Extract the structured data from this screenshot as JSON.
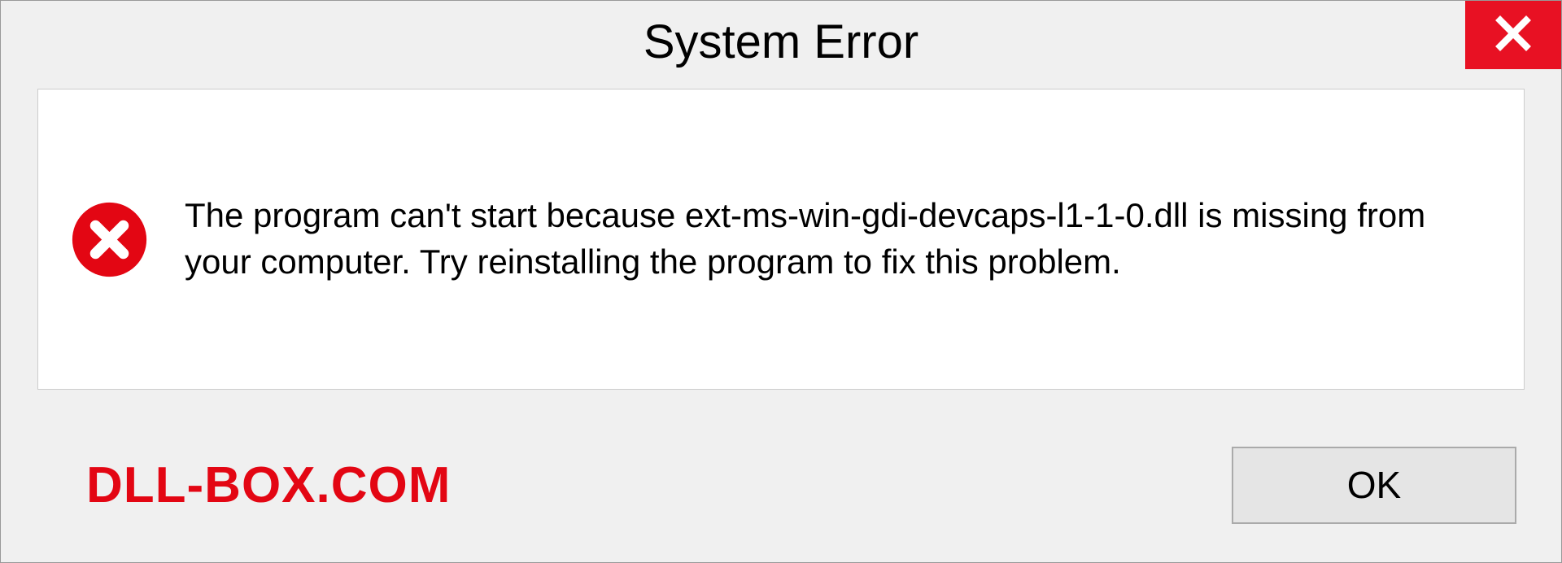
{
  "dialog": {
    "title": "System Error",
    "message": "The program can't start because ext-ms-win-gdi-devcaps-l1-1-0.dll is missing from your computer. Try reinstalling the program to fix this problem.",
    "ok_label": "OK"
  },
  "watermark": "DLL-BOX.COM",
  "colors": {
    "close_bg": "#e81123",
    "error_icon": "#e30613",
    "watermark": "#e30613"
  }
}
